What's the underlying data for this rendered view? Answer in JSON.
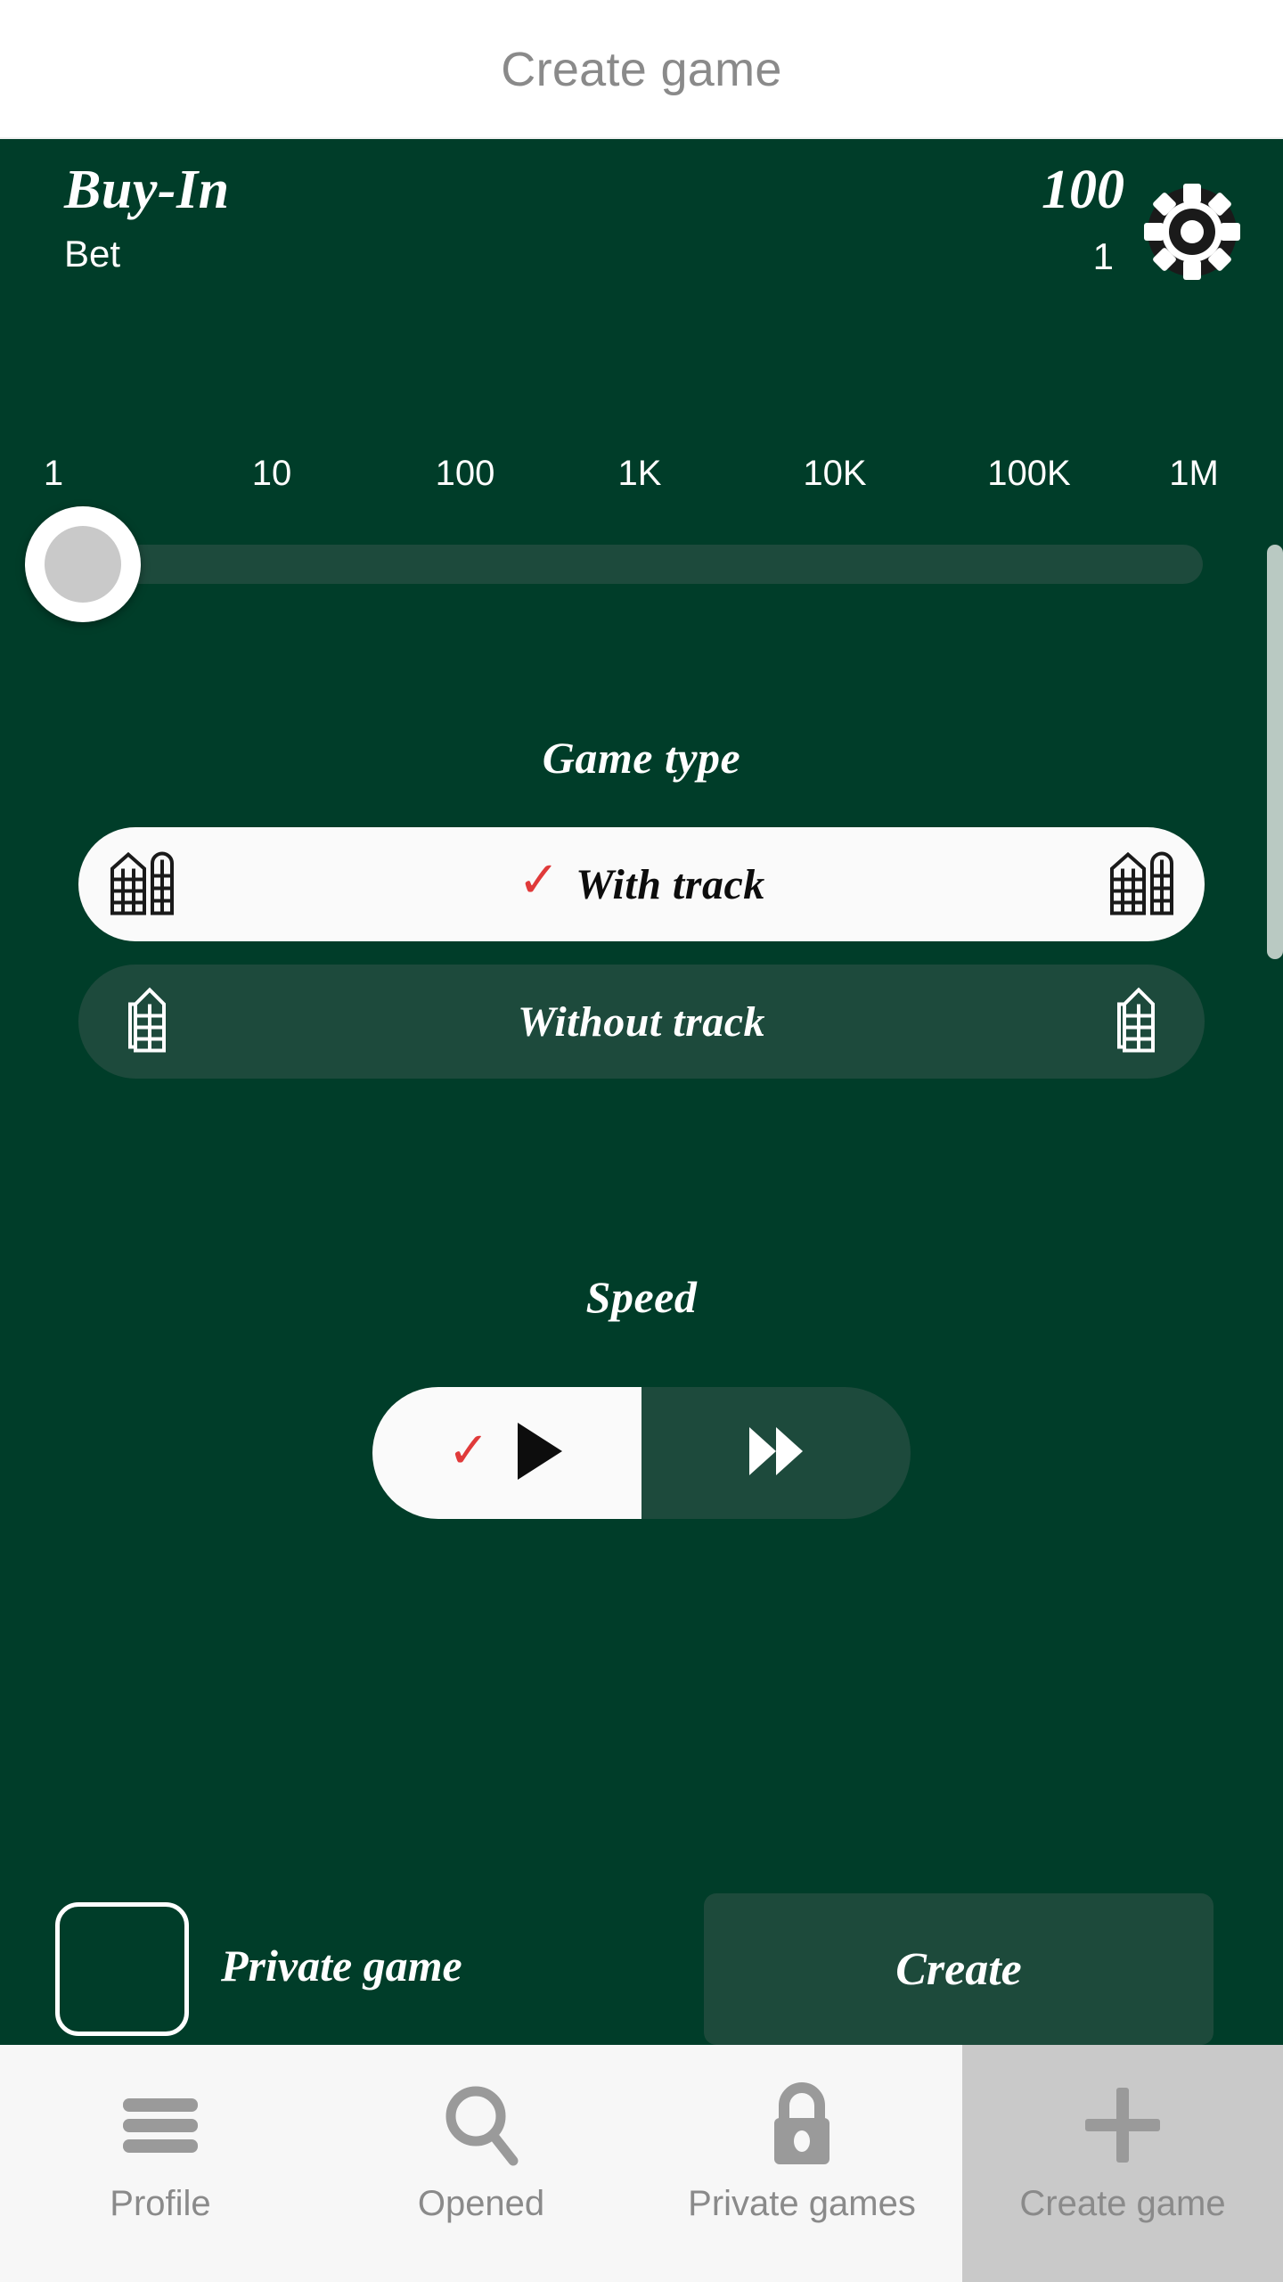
{
  "header": {
    "title": "Create game"
  },
  "buyin": {
    "title": "Buy-In",
    "subtitle": "Bet",
    "amount": "100",
    "chip_count": "1",
    "chip_icon": "poker-chip-icon"
  },
  "slider": {
    "value": "1",
    "ticks": [
      "1",
      "10",
      "100",
      "1K",
      "10K",
      "100K",
      "1M"
    ],
    "thumb_position_percent": 0
  },
  "game_type": {
    "title": "Game type",
    "options": [
      {
        "label": "With track",
        "selected": true,
        "icon": "nard-double-column-icon",
        "check": "✓"
      },
      {
        "label": "Without track",
        "selected": false,
        "icon": "nard-single-column-icon",
        "check": ""
      }
    ]
  },
  "speed": {
    "title": "Speed",
    "options": [
      {
        "icon": "play-icon",
        "selected": true,
        "check": "✓"
      },
      {
        "icon": "fast-forward-icon",
        "selected": false,
        "check": ""
      }
    ]
  },
  "bottom": {
    "private_game_label": "Private game",
    "private_game_checked": false,
    "create_label": "Create"
  },
  "nav": {
    "items": [
      {
        "label": "Profile",
        "icon": "hamburger-icon",
        "active": false
      },
      {
        "label": "Opened",
        "icon": "search-icon",
        "active": false
      },
      {
        "label": "Private games",
        "icon": "lock-icon",
        "active": false
      },
      {
        "label": "Create game",
        "icon": "plus-icon",
        "active": true
      }
    ]
  },
  "colors": {
    "background": "#003d29",
    "panel": "#1d4a3c",
    "accent_check": "#e03a3a",
    "selected_pill": "#fafafa",
    "nav_bg": "#f7f7f7",
    "nav_active_bg": "#c9c9c9",
    "nav_icon": "#9a9a9a",
    "header_text": "#8a8a8a"
  }
}
